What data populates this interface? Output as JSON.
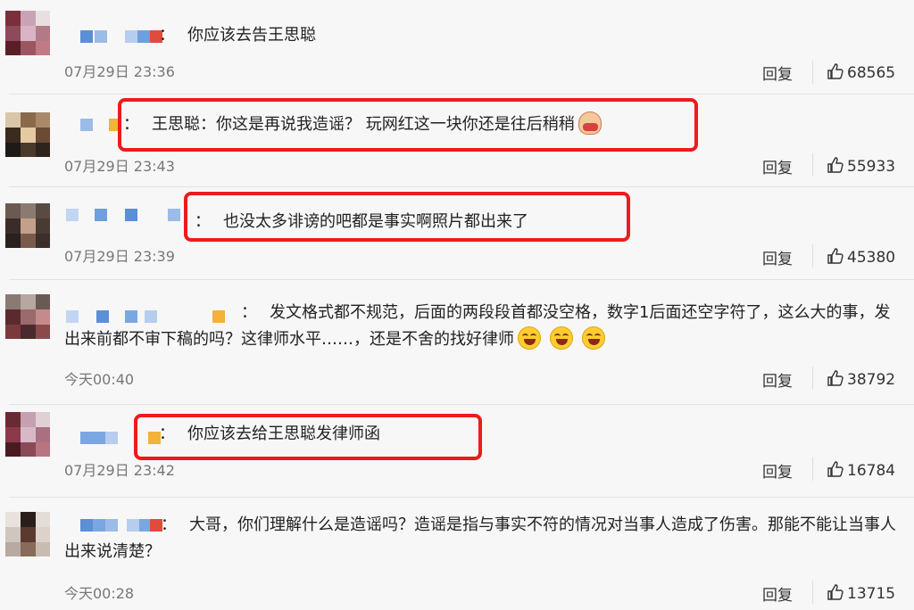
{
  "comments": [
    {
      "text": "你应该去告王思聪",
      "time": "07月29日 23:36",
      "reply_label": "回复",
      "likes": "68565",
      "emojis": []
    },
    {
      "text": "王思聪：你这是再说我造谣？ 玩网红这一块你还是往后稍稍",
      "time": "07月29日 23:43",
      "reply_label": "回复",
      "likes": "55933",
      "emojis": [
        "mask"
      ]
    },
    {
      "text": "也没太多诽谤的吧都是事实啊照片都出来了",
      "time": "07月29日 23:39",
      "reply_label": "回复",
      "likes": "45380",
      "emojis": []
    },
    {
      "text": "发文格式都不规范，后面的两段段首都没空格，数字1后面还空字符了，这么大的事，发出来前都不审下稿的吗？这律师水平……，还是不舍的找好律师",
      "time": "今天00:40",
      "reply_label": "回复",
      "likes": "38792",
      "emojis": [
        "lol",
        "lol",
        "lol"
      ]
    },
    {
      "text": "你应该去给王思聪发律师函",
      "time": "07月29日 23:42",
      "reply_label": "回复",
      "likes": "16784",
      "emojis": []
    },
    {
      "text": "大哥，你们理解什么是造谣吗？造谣是指与事实不符的情况对当事人造成了伤害。那能不能让当事人出来说清楚？",
      "time": "今天00:28",
      "reply_label": "回复",
      "likes": "13715",
      "emojis": []
    }
  ],
  "colon": "：",
  "colors": {
    "highlight": "#ee1b1b",
    "username_blur": "#4a86e8"
  }
}
